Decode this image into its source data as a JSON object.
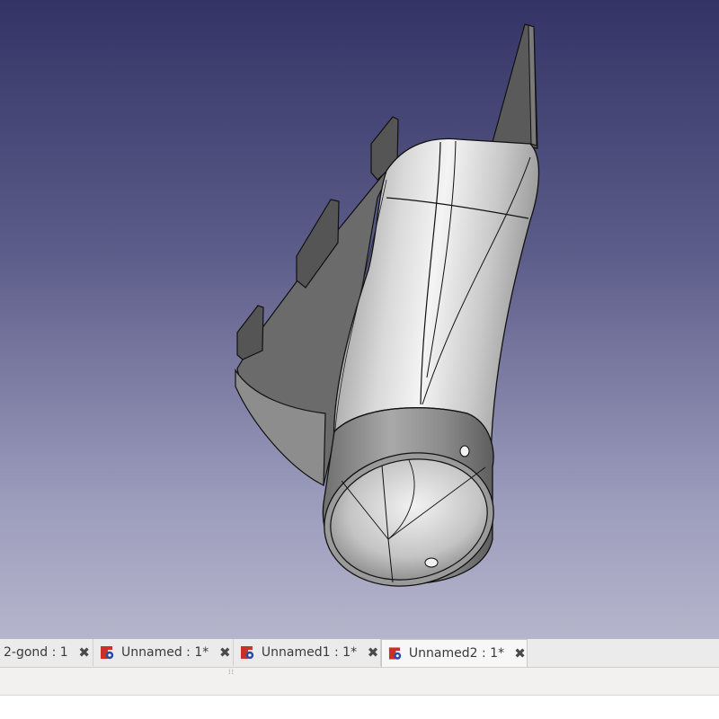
{
  "viewport": {
    "model": "3d-part-duct"
  },
  "tabs": [
    {
      "label": "2-gond : 1",
      "has_icon": false,
      "active": false
    },
    {
      "label": "Unnamed : 1*",
      "has_icon": true,
      "active": false
    },
    {
      "label": "Unnamed1 : 1*",
      "has_icon": true,
      "active": false
    },
    {
      "label": "Unnamed2 : 1*",
      "has_icon": true,
      "active": true
    }
  ],
  "icons": {
    "close": "close-icon",
    "document": "freecad-document-icon"
  },
  "colors": {
    "viewport_top": "#333366",
    "viewport_bottom": "#b5b5cc",
    "icon_red": "#c8302a",
    "icon_blue": "#2b4aa8"
  }
}
